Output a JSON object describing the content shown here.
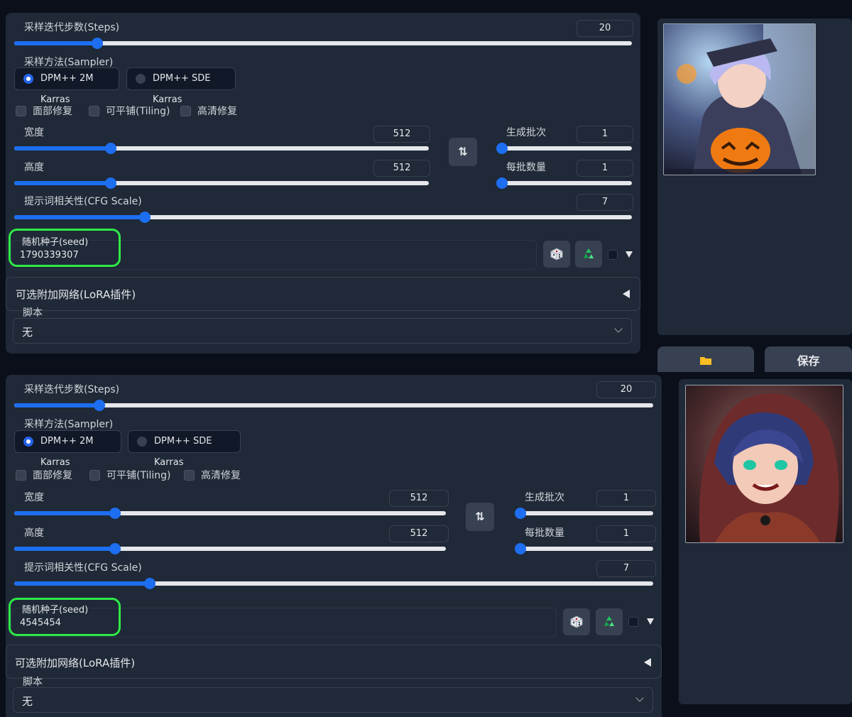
{
  "top": {
    "steps": {
      "label": "采样迭代步数(Steps)",
      "value": "20"
    },
    "sampler": {
      "label": "采样方法(Sampler)",
      "options": [
        "DPM++ 2M Karras",
        "DPM++ SDE Karras"
      ],
      "selected": "DPM++ 2M Karras"
    },
    "checkboxes": [
      "面部修复",
      "可平铺(Tiling)",
      "高清修复"
    ],
    "width": {
      "label": "宽度",
      "value": "512"
    },
    "height": {
      "label": "高度",
      "value": "512"
    },
    "batch_count": {
      "label": "生成批次",
      "value": "1"
    },
    "batch_size": {
      "label": "每批数量",
      "value": "1"
    },
    "cfg": {
      "label": "提示词相关性(CFG Scale)",
      "value": "7"
    },
    "seed": {
      "label": "随机种子(seed)",
      "value": "1790339307"
    },
    "lora": {
      "label": "可选附加网络(LoRA插件)"
    },
    "script": {
      "label": "脚本",
      "value": "无"
    }
  },
  "bottom": {
    "steps": {
      "label": "采样迭代步数(Steps)",
      "value": "20"
    },
    "sampler": {
      "label": "采样方法(Sampler)",
      "options": [
        "DPM++ 2M Karras",
        "DPM++ SDE Karras"
      ],
      "selected": "DPM++ 2M Karras"
    },
    "checkboxes": [
      "面部修复",
      "可平铺(Tiling)",
      "高清修复"
    ],
    "width": {
      "label": "宽度",
      "value": "512"
    },
    "height": {
      "label": "高度",
      "value": "512"
    },
    "batch_count": {
      "label": "生成批次",
      "value": "1"
    },
    "batch_size": {
      "label": "每批数量",
      "value": "1"
    },
    "cfg": {
      "label": "提示词相关性(CFG Scale)",
      "value": "7"
    },
    "seed": {
      "label": "随机种子(seed)",
      "value": "4545454"
    },
    "lora": {
      "label": "可选附加网络(LoRA插件)"
    },
    "script": {
      "label": "脚本",
      "value": "无"
    }
  },
  "actions": {
    "save_label": "保存"
  },
  "icons": {
    "swap": "swap-icon",
    "dice": "dice-icon",
    "recycle": "recycle-icon",
    "folder": "folder-icon"
  },
  "colors": {
    "accent": "#1d6ef0",
    "highlight": "#2eea47",
    "panel": "#1f2937",
    "background": "#0b0f19"
  }
}
